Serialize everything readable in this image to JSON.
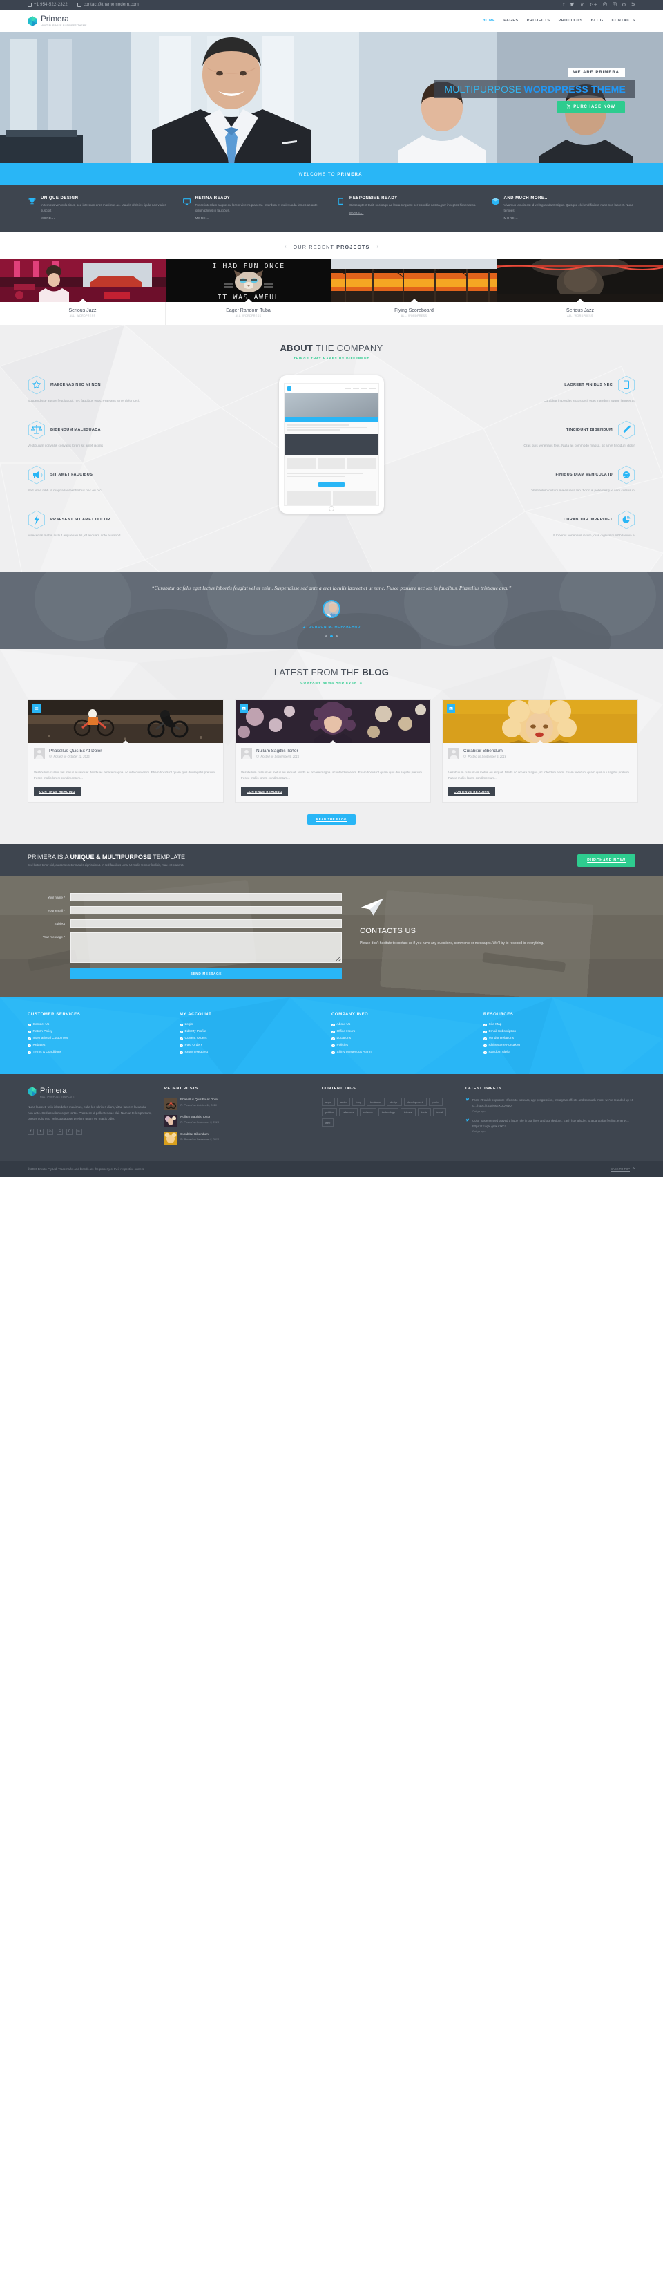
{
  "topbar": {
    "phone": "+1 954-522-2322",
    "email": "contact@thememodern.com",
    "socials": [
      "facebook-icon",
      "twitter-icon",
      "linkedin-icon",
      "google-plus-icon",
      "pinterest-icon",
      "instagram-icon",
      "github-icon",
      "rss-icon"
    ],
    "social_glyphs": [
      "f",
      "🐦",
      "in",
      "G+",
      "P",
      "◙",
      "O",
      "≫"
    ]
  },
  "brand": {
    "name": "Primera",
    "tagline": "MULTIPURPOSE BUSINESS THEME"
  },
  "nav": [
    {
      "label": "HOME",
      "active": true
    },
    {
      "label": "PAGES",
      "active": false
    },
    {
      "label": "PROJECTS",
      "active": false
    },
    {
      "label": "PRODUCTS",
      "active": false
    },
    {
      "label": "BLOG",
      "active": false
    },
    {
      "label": "CONTACTS",
      "active": false
    }
  ],
  "hero": {
    "kicker": "WE ARE PRIMERA",
    "title_light": "MULTIPURPOSE",
    "title_bold": "WORDPRESS THEME",
    "cta": "PURCHASE NOW"
  },
  "welcome": {
    "pre": "WELCOME TO ",
    "brand": "PRIMERA",
    "post": "!"
  },
  "features": [
    {
      "icon": "trophy-icon",
      "title": "UNIQUE DESIGN",
      "text": "In tempus vehicula risus, sed interdum eros maximus ac. Mauris ultricies ligula nec varius suscipit",
      "more": "MORE..."
    },
    {
      "icon": "monitor-icon",
      "title": "RETINA READY",
      "text": "Fusce interdum augue eu lorem viverra placerat. Interdum et malesuada fames ac ante ipsum primis in faucibus.",
      "more": "MORE..."
    },
    {
      "icon": "mobile-icon",
      "title": "RESPONSIVE READY",
      "text": "Class aptent taciti sociosqu ad litora torquent per conubia nostra, per inceptos himenaeos.",
      "more": "MORE..."
    },
    {
      "icon": "box-icon",
      "title": "AND MUCH MORE...",
      "text": "Vivamus iaculis est id velit gravida tristique. Quisque eleifend finibus nunc non laoreet. Nunc tempest",
      "more": "MORE..."
    }
  ],
  "projects": {
    "heading_light": "OUR RECENT ",
    "heading_bold": "PROJECTS",
    "prev_icon": "chevron-left-icon",
    "next_icon": "chevron-right-icon",
    "items": [
      {
        "name": "Serious Jazz",
        "cat": "ALL, WORDPRESS"
      },
      {
        "name": "Eager Random Tuba",
        "cat": "ALL, WORDPRESS"
      },
      {
        "name": "Flying Scoreboard",
        "cat": "ALL, WORDPRESS"
      },
      {
        "name": "Serious Jazz",
        "cat": "ALL, WORDPRESS"
      }
    ]
  },
  "about": {
    "title_bold": "ABOUT",
    "title_light": " THE COMPANY",
    "subtitle": "THINGS THAT MAKES US DIFFERENT",
    "left": [
      {
        "icon": "star-icon",
        "title": "MAECENAS NEC MI NON",
        "text": "Suspendisse auctor feugiat dui, nec faucibus eros. Praesent amet dolor orci."
      },
      {
        "icon": "scales-icon",
        "title": "BIBENDUM MALESUADA",
        "text": "Vestibulum convallis convallis lorem sit amet iaculis"
      },
      {
        "icon": "megaphone-icon",
        "title": "SIT AMET FAUCIBUS",
        "text": "Sed vitae nibh ut magna laoreet finibus nec eu orci"
      },
      {
        "icon": "bolt-icon",
        "title": "PRAESENT SIT AMET DOLOR",
        "text": "Maecenas mattis nisl ut augue iaculis, et aliquam ante euismod"
      }
    ],
    "right": [
      {
        "icon": "tablet-icon",
        "title": "LAOREET FINIBUS NEC",
        "text": "Curabitur imperdiet lectus orci, eget interdum augue laoreet at."
      },
      {
        "icon": "wand-icon",
        "title": "TINCIDUNT BIBENDUM",
        "text": "Cras quis venenatis felis. Nulla ac commodo massa, sit amet tincidunt dolor."
      },
      {
        "icon": "globe-icon",
        "title": "FINIBUS DIAM VEHICULA ID",
        "text": "Vestibulum dictum malesuada leo rhoncus pellentesque sem cursus in."
      },
      {
        "icon": "piechart-icon",
        "title": "CURABITUR IMPERDIET",
        "text": "Ut lobortis venenatis ipsum, quis dignissim nibh lacinia a."
      }
    ]
  },
  "testimonial": {
    "quote": "“Curabitur ac felis eget lectus lobortis feugiat vel ut enim. Suspendisse sed ante a erat iaculis laoreet et ut nunc. Fusce posuere nec leo in faucibus. Phasellus tristique arcu”",
    "author": "GORDON M. MCFARLAND",
    "author_icon": "user-icon",
    "dots": 3,
    "active_dot": 1
  },
  "blog": {
    "title_light": "LATEST FROM THE ",
    "title_bold": "BLOG",
    "subtitle": "COMPANY NEWS AND EVENTS",
    "posts": [
      {
        "tag_icon": "list-icon",
        "title": "Phasellus Quis Ex At Dolor",
        "date": "Posted on October 11, 2016",
        "excerpt": "Vestibulum cursus vel metus eu aliquet. Morbi ac ornare magna, ac interdum enim. Etiam tincidunt quam quis dui sagittis pretium. Fusce mollis lorem condimentum...",
        "more": "CONTINUE READING"
      },
      {
        "tag_icon": "image-icon",
        "title": "Nullam Sagittis Tortor",
        "date": "Posted on September 5, 2016",
        "excerpt": "Vestibulum cursus vel metus eu aliquet. Morbi ac ornare magna, ac interdum enim. Etiam tincidunt quam quis dui sagittis pretium. Fusce mollis lorem condimentum...",
        "more": "CONTINUE READING"
      },
      {
        "tag_icon": "image-icon",
        "title": "Curabitur Bibendum",
        "date": "Posted on September 5, 2016",
        "excerpt": "Vestibulum cursus vel metus eu aliquet. Morbi ac ornare magna, ac interdum enim. Etiam tincidunt quam quis dui sagittis pretium. Fusce mollis lorem condimentum...",
        "more": "CONTINUE READING"
      }
    ],
    "read_blog": "READ THE BLOG"
  },
  "cta": {
    "pre": "PRIMERA IS A ",
    "bold": "UNIQUE & MULTIPURPOSE",
    "post": " TEMPLATE",
    "sub": "Sed luctus tortor nisl, eu consectetur mauris dignissim ut. In sed faucibus urna. Ut mollis tempor facilisis, mau est placerat.",
    "button": "PURCHASE NOW!"
  },
  "contact": {
    "fields": [
      {
        "label": "Your name *",
        "value": "",
        "placeholder": ""
      },
      {
        "label": "Your email *",
        "value": "",
        "placeholder": ""
      },
      {
        "label": "Subject",
        "value": "",
        "placeholder": ""
      },
      {
        "label": "Your message *",
        "value": "",
        "placeholder": ""
      }
    ],
    "submit": "SEND MESSAGE",
    "heading": "CONTACTS US",
    "text": "Please don't hesitate to contact us if you have any questions, comments or messages. We'll try to respond to everything.",
    "plane_icon": "paper-plane-icon"
  },
  "footer_links": [
    {
      "title": "CUSTOMER SERVICES",
      "items": [
        "Contact Us",
        "Return Policy",
        "International Customers",
        "Rebates",
        "Terms & Conditions"
      ]
    },
    {
      "title": "MY ACCOUNT",
      "items": [
        "Login",
        "Edit My Profile",
        "Current Orders",
        "Past Orders",
        "Return Request"
      ]
    },
    {
      "title": "COMPANY INFO",
      "items": [
        "About Us",
        "Office Hours",
        "Locations",
        "Policies",
        "Shiny Mysterious Alarm"
      ]
    },
    {
      "title": "RESOURCES",
      "items": [
        "Site Map",
        "Email Subscription",
        "Vendor Relations",
        "Rhinestone Forsaken",
        "Random Alpha"
      ]
    }
  ],
  "footer": {
    "brand_name": "Primera",
    "brand_tagline": "MULTIPURPOSE TEMPLATE",
    "about": "Nunc laoreet, felis id sodales maximus, nulla leo ultrices diam, vitae laoreet lacus dui non ante. Sed ac ullamcorper tortor. Praesent id pellentesque dui. Nam ut tellus pretium, cursus odio nec, vehicula augue pretium quam et, mattis odio.",
    "socials": [
      "facebook-icon",
      "twitter-icon",
      "linkedin-icon",
      "google-plus-icon",
      "pinterest-icon",
      "rss-icon"
    ],
    "social_glyphs": [
      "f",
      "🐦",
      "in",
      "G+",
      "P",
      "≫"
    ],
    "recent_title": "RECENT POSTS",
    "recent": [
      {
        "title": "Phasellus Quis Ex At Dolor",
        "date": "Posted on October 11, 2016"
      },
      {
        "title": "Nullam Sagittis Tortor",
        "date": "Posted on September 5, 2016"
      },
      {
        "title": "Curabitur Bibendum",
        "date": "Posted on September 5, 2016"
      }
    ],
    "tags_title": "CONTENT TAGS",
    "tags": [
      "apps",
      "audio",
      "blog",
      "business",
      "design",
      "development",
      "photo",
      "politics",
      "reference",
      "science",
      "technology",
      "tutorial",
      "tools",
      "travel",
      "web"
    ],
    "tweets_title": "LATEST TWEETS",
    "tweets": [
      {
        "icon": "twitter-icon",
        "text": "From #trouble exposure effects to cat ears, age progression, Instagram effects and so much more, we've rounded up 10 c... https://t.co/jNsEXOOewQ",
        "date": "7 days ago"
      },
      {
        "icon": "twitter-icon",
        "text": "Color has emerged played a huge role in our lives and our designs. Each hue alludes to a particular feeling, energy... https://t.co/jaLgmKAzKcz",
        "date": "2 days ago"
      }
    ]
  },
  "copyright": {
    "text": "© 2016 Envato Pty Ltd. Trademarks and brands are the property of their respective owners.",
    "back_to_top": "BACK TO TOP",
    "back_icon": "chevron-up-icon"
  }
}
